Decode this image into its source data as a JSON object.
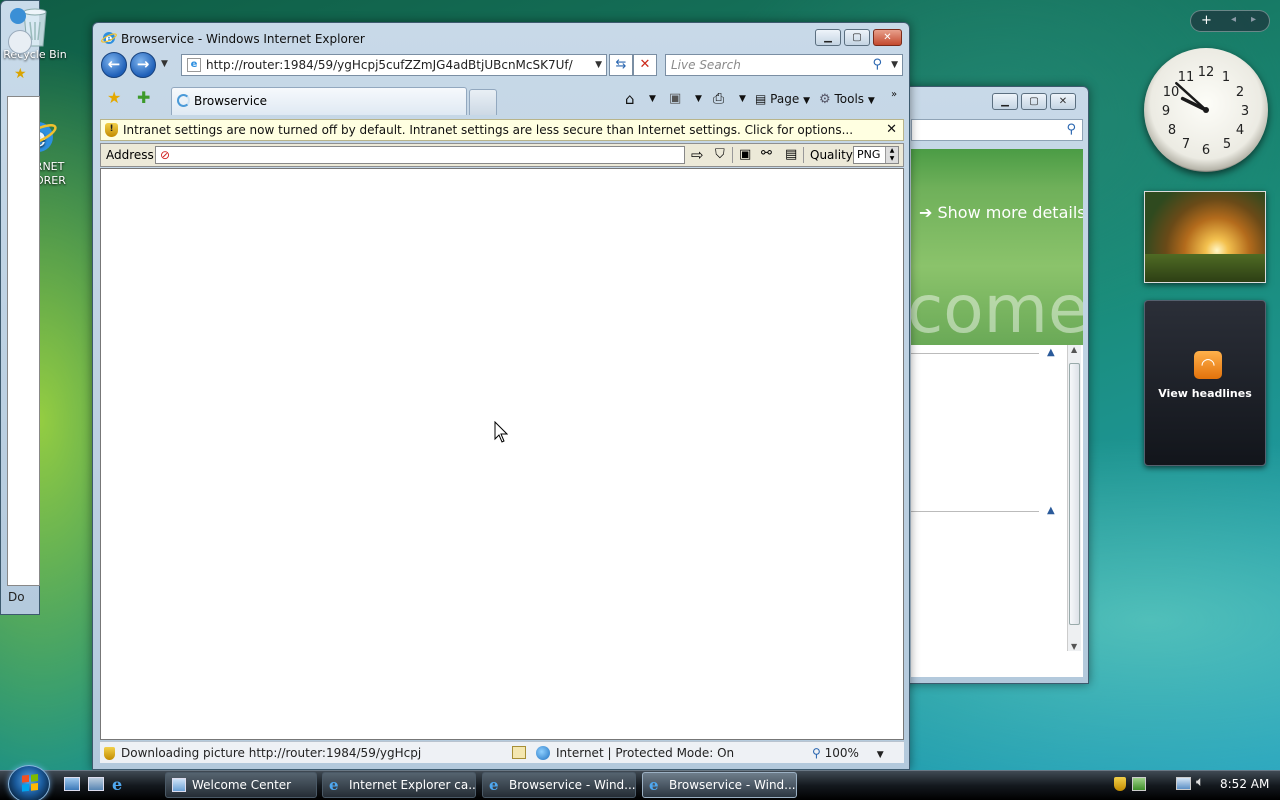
{
  "desktop": {
    "icons": [
      {
        "label": "Recycle Bin"
      },
      {
        "label_line1": "INTERNET",
        "label_line2": "EXPLORER"
      }
    ]
  },
  "ie_window": {
    "title": "Browservice - Windows Internet Explorer",
    "address_url": "http://router:1984/59/ygHcpj5cufZZmJG4adBtjUBcnMcSK7Uf/",
    "search_placeholder": "Live Search",
    "tab_label": "Browservice",
    "command_bar": {
      "page_label": "Page",
      "tools_label": "Tools"
    },
    "infobar_text": "Intranet settings are now turned off by default. Intranet settings are less secure than Internet settings. Click for options...",
    "browservice_bar": {
      "address_label": "Address",
      "address_value": "",
      "quality_label": "Quality",
      "quality_value": "PNG"
    },
    "status": {
      "text": "Downloading picture http://router:1984/59/ygHcpj",
      "zone": "Internet | Protected Mode: On",
      "zoom": "100%"
    }
  },
  "back_window": {
    "status_fragment": "Do"
  },
  "welcome_window": {
    "show_more_details": "Show more details",
    "banner_text": "come"
  },
  "gadgets": {
    "clock": {
      "time_hour": 9,
      "time_minute": 52
    },
    "feeds_label": "View headlines"
  },
  "taskbar": {
    "items": [
      {
        "label": "Welcome Center",
        "active": false
      },
      {
        "label": "Internet Explorer ca...",
        "active": false
      },
      {
        "label": "Browservice - Wind...",
        "active": false
      },
      {
        "label": "Browservice - Wind...",
        "active": true
      }
    ],
    "clock": "8:52 AM"
  },
  "colors": {
    "infobar_bg": "#ffffe1",
    "close_button": "#c3492e",
    "welcome_green": "#6fb05a"
  }
}
